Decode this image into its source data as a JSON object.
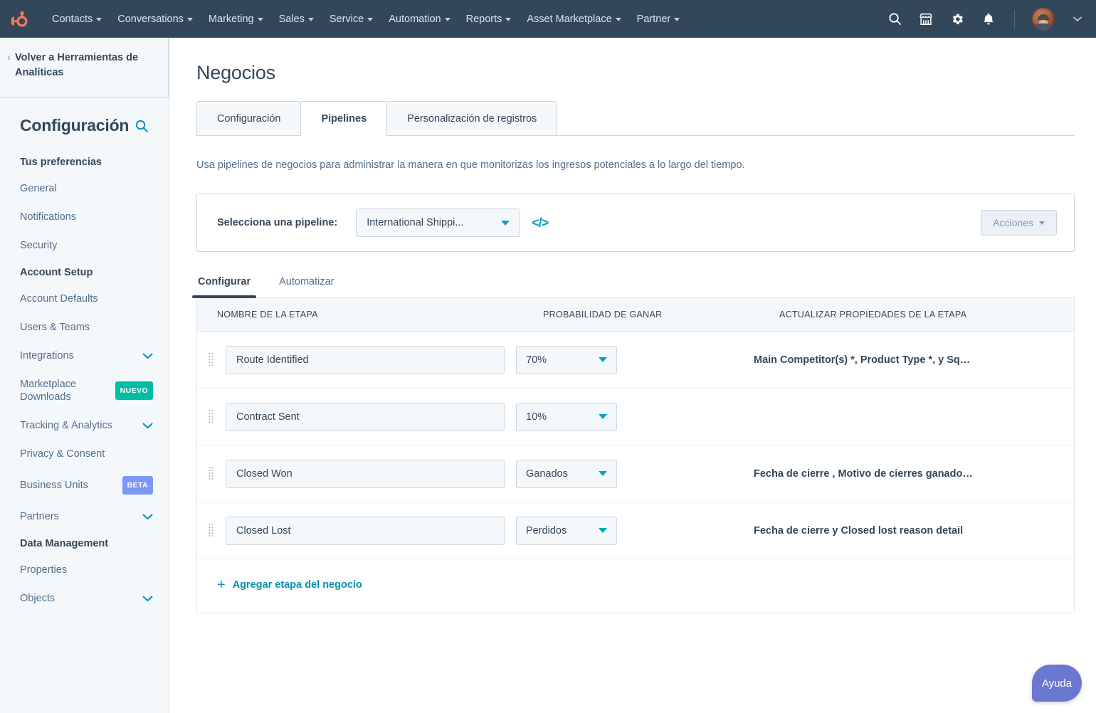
{
  "topnav": {
    "logo": "hubspot-sprocket-logo",
    "links": [
      {
        "label": "Contacts"
      },
      {
        "label": "Conversations"
      },
      {
        "label": "Marketing"
      },
      {
        "label": "Sales"
      },
      {
        "label": "Service"
      },
      {
        "label": "Automation"
      },
      {
        "label": "Reports"
      },
      {
        "label": "Asset Marketplace"
      },
      {
        "label": "Partner"
      }
    ],
    "icons": [
      "search-icon",
      "marketplace-icon",
      "gear-icon",
      "notifications-bell-icon"
    ]
  },
  "sidebar": {
    "back_link": "Volver a Herramientas de Analíticas",
    "title": "Configuración",
    "search_icon": "search-icon",
    "groups": [
      {
        "heading": "Tus preferencias",
        "items": [
          {
            "label": "General",
            "chevron": false,
            "badge": null
          },
          {
            "label": "Notifications",
            "chevron": false,
            "badge": null
          },
          {
            "label": "Security",
            "chevron": false,
            "badge": null
          }
        ]
      },
      {
        "heading": "Account Setup",
        "items": [
          {
            "label": "Account Defaults",
            "chevron": false,
            "badge": null
          },
          {
            "label": "Users & Teams",
            "chevron": false,
            "badge": null
          },
          {
            "label": "Integrations",
            "chevron": true,
            "badge": null
          },
          {
            "label": "Marketplace Downloads",
            "chevron": false,
            "badge": "NUEVO",
            "badge_type": "nuevo"
          },
          {
            "label": "Tracking & Analytics",
            "chevron": true,
            "badge": null
          },
          {
            "label": "Privacy & Consent",
            "chevron": false,
            "badge": null
          },
          {
            "label": "Business Units",
            "chevron": false,
            "badge": "BETA",
            "badge_type": "beta"
          },
          {
            "label": "Partners",
            "chevron": true,
            "badge": null
          }
        ]
      },
      {
        "heading": "Data Management",
        "items": [
          {
            "label": "Properties",
            "chevron": false,
            "badge": null
          },
          {
            "label": "Objects",
            "chevron": true,
            "badge": null
          }
        ]
      }
    ]
  },
  "main": {
    "page_title": "Negocios",
    "tabs": [
      {
        "label": "Configuración",
        "active": false
      },
      {
        "label": "Pipelines",
        "active": true
      },
      {
        "label": "Personalización de registros",
        "active": false
      }
    ],
    "description": "Usa pipelines de negocios para administrar la manera en que monitorizas los ingresos potenciales a lo largo del tiempo.",
    "pipeline_card": {
      "label": "Selecciona una pipeline:",
      "selected_pipeline": "International Shippi...",
      "code_icon": "</>",
      "actions_button": "Acciones"
    },
    "subtabs": [
      {
        "label": "Configurar",
        "active": true
      },
      {
        "label": "Automatizar",
        "active": false
      }
    ],
    "table": {
      "columns": [
        "NOMBRE DE LA ETAPA",
        "PROBABILIDAD DE GANAR",
        "ACTUALIZAR PROPIEDADES DE LA ETAPA"
      ],
      "rows": [
        {
          "stage": "Route Identified",
          "probability": "70%",
          "properties": "Main Competitor(s) *, Product Type *, y Sq…"
        },
        {
          "stage": "Contract Sent",
          "probability": "10%",
          "properties": ""
        },
        {
          "stage": "Closed Won",
          "probability": "Ganados",
          "properties": "Fecha de cierre , Motivo de cierres ganado…"
        },
        {
          "stage": "Closed Lost",
          "probability": "Perdidos",
          "properties": "Fecha de cierre y Closed lost reason detail"
        }
      ],
      "add_stage_label": "Agregar etapa del negocio"
    }
  },
  "help_button": {
    "label": "Ayuda"
  },
  "colors": {
    "nav_bg": "#33475b",
    "logo_orange": "#ff7a59",
    "link_teal": "#0091ae",
    "accent_cyan": "#00a4bd",
    "badge_nuevo": "#00bda5",
    "badge_beta": "#7c98f7",
    "help_purple": "#6a78d1",
    "sidebar_bg": "#f5f8fa"
  }
}
